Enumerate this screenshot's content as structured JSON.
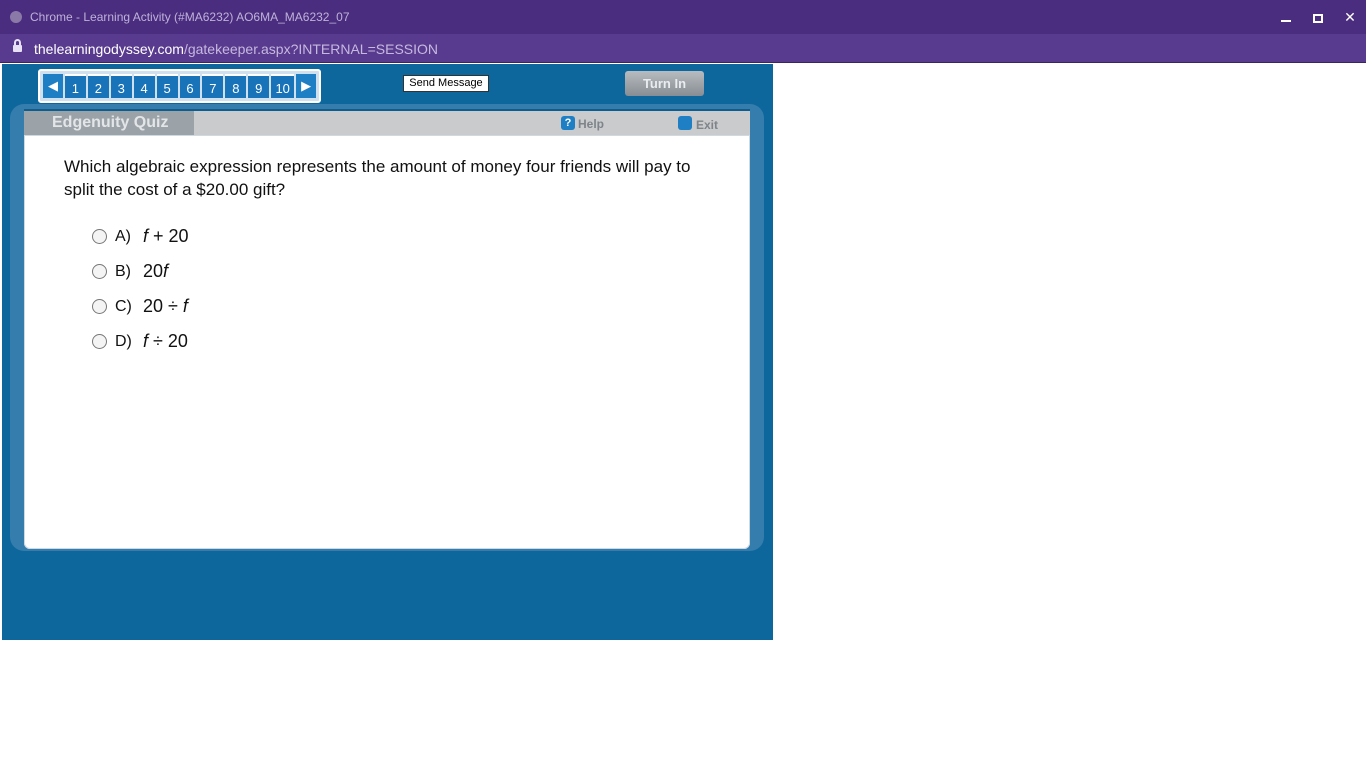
{
  "window": {
    "title": "Chrome - Learning Activity (#MA6232) AO6MA_MA6232_07",
    "url_domain": "thelearningodyssey.com",
    "url_path": "/gatekeeper.aspx?INTERNAL=SESSION"
  },
  "nav": {
    "prev_label": "◀",
    "next_label": "▶",
    "questions": [
      "1",
      "2",
      "3",
      "4",
      "5",
      "6",
      "7",
      "8",
      "9",
      "10"
    ]
  },
  "toolbar": {
    "send_message": "Send Message",
    "turn_in": "Turn In"
  },
  "quiz": {
    "header": "Edgenuity Quiz",
    "help": "Help",
    "exit": "Exit",
    "question": "Which algebraic expression represents the amount of money four friends will pay to split the cost of a $20.00 gift?",
    "choices": [
      {
        "letter": "A)",
        "pre": "",
        "var": "f",
        "post": " + 20"
      },
      {
        "letter": "B)",
        "pre": "20",
        "var": "f",
        "post": ""
      },
      {
        "letter": "C)",
        "pre": "20 ÷ ",
        "var": "f",
        "post": ""
      },
      {
        "letter": "D)",
        "pre": "",
        "var": "f",
        "post": " ÷ 20"
      }
    ]
  },
  "colors": {
    "titlebar": "#4a2d7f",
    "urlbar": "#583a8f",
    "app_background": "#0e679c",
    "nav_button": "#1973b8"
  }
}
